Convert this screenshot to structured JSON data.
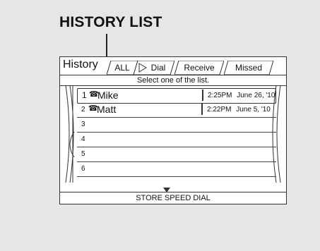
{
  "callout": {
    "label": "HISTORY LIST"
  },
  "header": {
    "title": "History",
    "tabs": [
      {
        "label": "ALL"
      },
      {
        "label": "Dial"
      },
      {
        "label": "Receive"
      },
      {
        "label": "Missed"
      }
    ]
  },
  "subheader": {
    "text": "Select one of the list."
  },
  "rows": [
    {
      "num": "1",
      "name": "Mike",
      "time": "2:25PM",
      "date": "June 26, '10"
    },
    {
      "num": "2",
      "name": "Matt",
      "time": "2:22PM",
      "date": "June  5, '10"
    },
    {
      "num": "3"
    },
    {
      "num": "4"
    },
    {
      "num": "5"
    },
    {
      "num": "6"
    }
  ],
  "footer": {
    "label": "STORE SPEED DIAL"
  }
}
